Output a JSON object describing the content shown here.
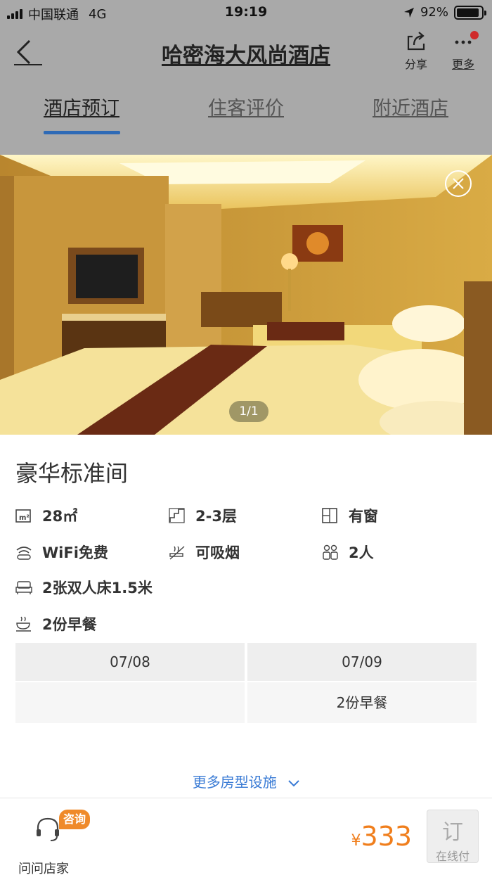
{
  "status_bar": {
    "carrier": "中国联通",
    "network": "4G",
    "time": "19:19",
    "battery": "92%",
    "battery_level": 0.92
  },
  "nav": {
    "title": "哈密海大风尚酒店",
    "share_label": "分享",
    "more_label": "更多"
  },
  "tabs": [
    {
      "label": "酒店预订",
      "active": true
    },
    {
      "label": "住客评价",
      "active": false
    },
    {
      "label": "附近酒店",
      "active": false
    }
  ],
  "gallery": {
    "counter": "1/1"
  },
  "room": {
    "name": "豪华标准间",
    "facilities": {
      "area": "28㎡",
      "floor": "2-3层",
      "window": "有窗",
      "wifi": "WiFi免费",
      "smoking": "可吸烟",
      "occupancy": "2人",
      "bed": "2张双人床1.5米",
      "breakfast": "2份早餐"
    }
  },
  "dates": [
    {
      "date": "07/08",
      "breakfast": ""
    },
    {
      "date": "07/09",
      "breakfast": "2份早餐"
    }
  ],
  "more_facilities": "更多房型设施",
  "bottom": {
    "ask_label": "问问店家",
    "consult_badge": "咨询",
    "currency": "¥",
    "price": "333",
    "book_label": "订",
    "book_sub": "在线付"
  },
  "colors": {
    "accent_blue": "#2e6ab6",
    "link_blue": "#3a7bd5",
    "price_orange": "#f07e1c",
    "badge_orange": "#ef8a2a"
  }
}
